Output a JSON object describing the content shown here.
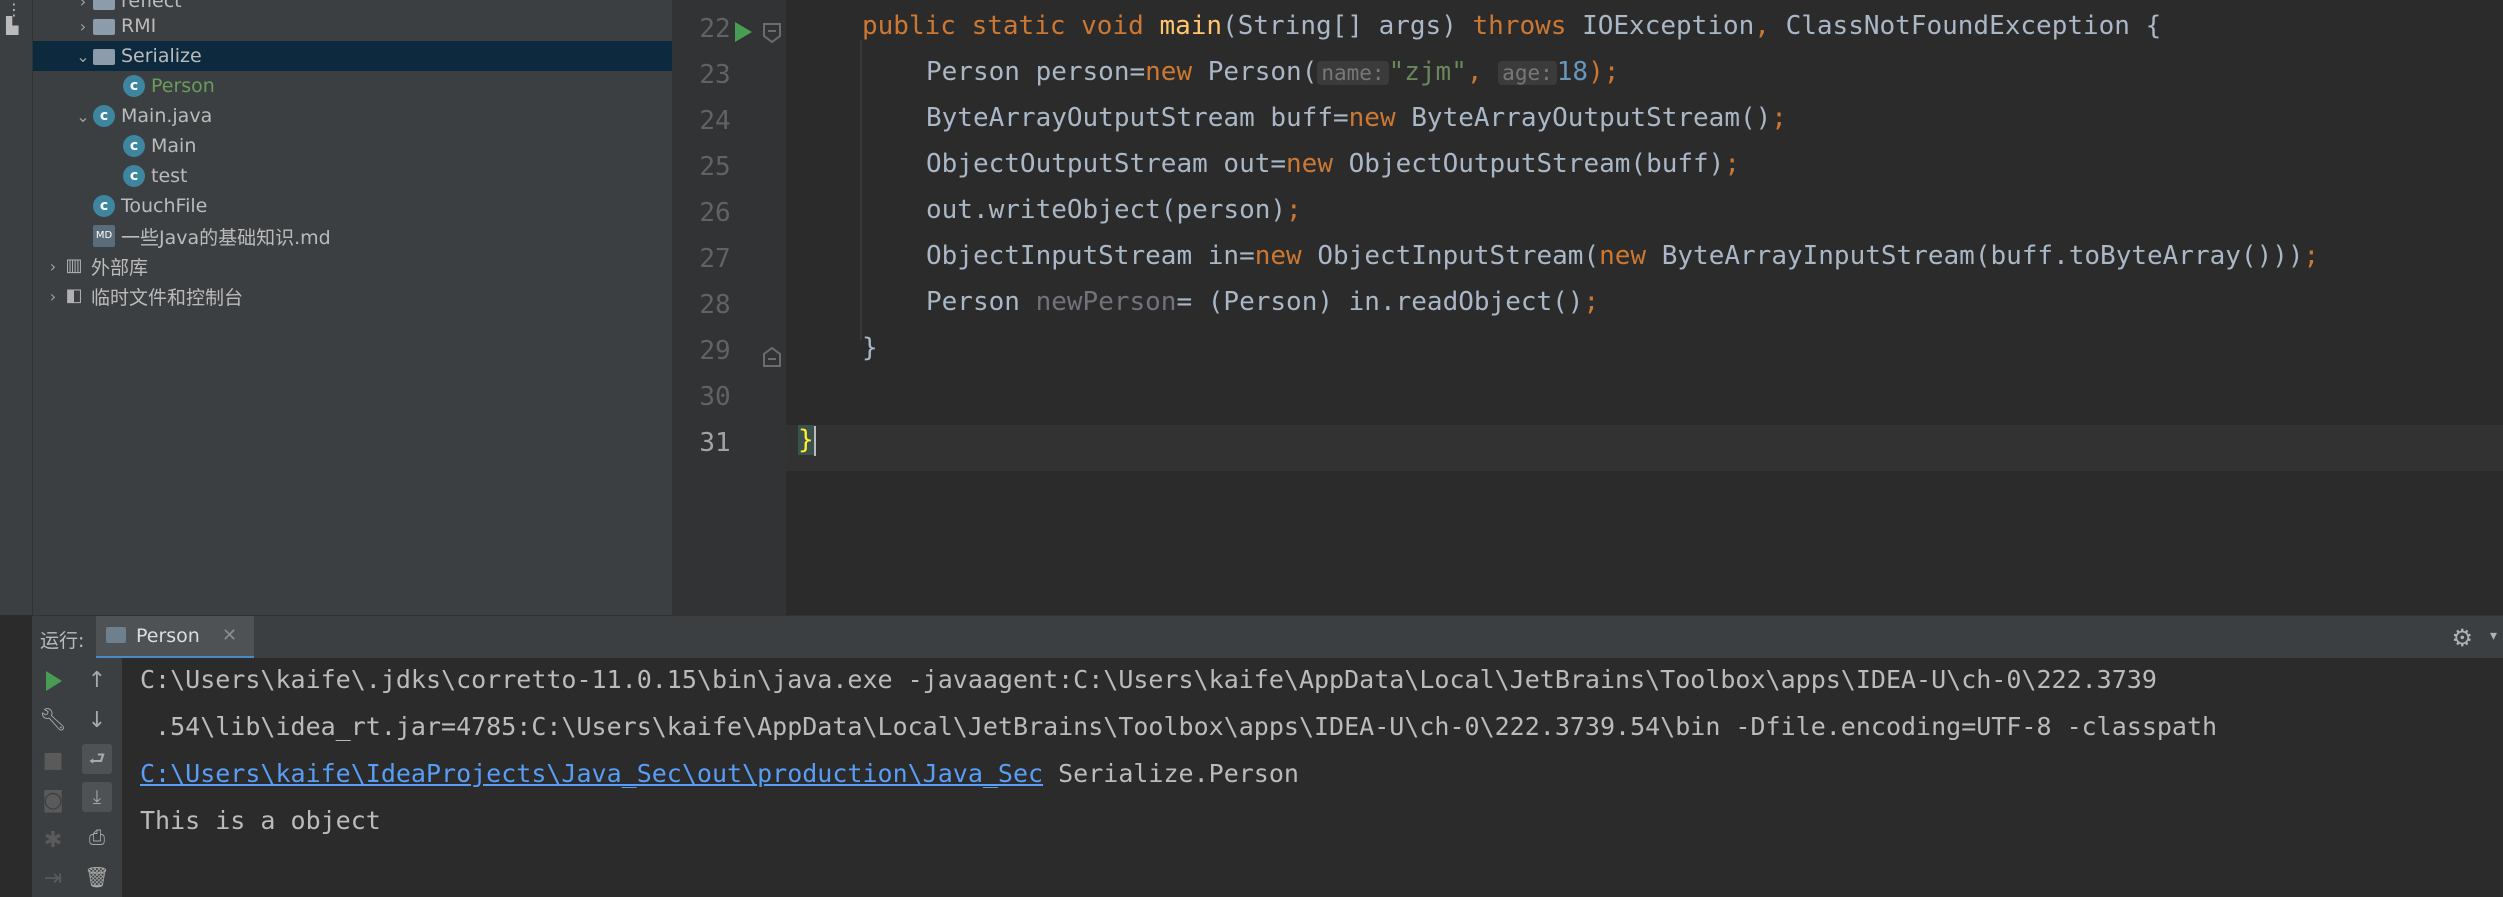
{
  "project_tree": [
    {
      "label": "reflect",
      "icon": "folder-icon",
      "expanded": false,
      "depth": 1
    },
    {
      "label": "RMI",
      "icon": "folder-icon",
      "expanded": false,
      "depth": 1
    },
    {
      "label": "Serialize",
      "icon": "folder-icon",
      "expanded": true,
      "depth": 1,
      "selected": true
    },
    {
      "label": "Person",
      "icon": "class-icon",
      "depth": 2
    },
    {
      "label": "Main.java",
      "icon": "java-file-icon",
      "expanded": true,
      "depth": 1
    },
    {
      "label": "Main",
      "icon": "class-icon",
      "depth": 2
    },
    {
      "label": "test",
      "icon": "class-icon",
      "depth": 2
    },
    {
      "label": "TouchFile",
      "icon": "class-icon",
      "depth": 1
    },
    {
      "label": "一些Java的基础知识.md",
      "icon": "markdown-file-icon",
      "depth": 1
    },
    {
      "label": "外部库",
      "icon": "library-icon",
      "expanded": false,
      "depth": 0
    },
    {
      "label": "临时文件和控制台",
      "icon": "scratch-icon",
      "expanded": false,
      "depth": 0
    }
  ],
  "editor": {
    "line_numbers": [
      "22",
      "23",
      "24",
      "25",
      "26",
      "27",
      "28",
      "29",
      "30",
      "31"
    ],
    "current_line": "31",
    "code": {
      "l22": {
        "public": "public",
        "static": "static",
        "void": "void",
        "main": "main",
        "params": "(String[] args) ",
        "throws": "throws",
        "exc1": " IOException",
        "comma": ",",
        "exc2": " ClassNotFoundException {"
      },
      "l23": {
        "a": "Person person=",
        "new": "new",
        "b": " Person(",
        "hint_name": "name:",
        "str": "\"zjm\"",
        "c": ",",
        "hint_age": "age:",
        "num": "18",
        "d": ");"
      },
      "l24": {
        "a": "ByteArrayOutputStream buff=",
        "new": "new",
        "b": " ByteArrayOutputStream()",
        "semi": ";"
      },
      "l25": {
        "a": "ObjectOutputStream out=",
        "new": "new",
        "b": " ObjectOutputStream(buff)",
        "semi": ";"
      },
      "l26": {
        "a": "out.writeObject(person)",
        "semi": ";"
      },
      "l27": {
        "a": "ObjectInputStream in=",
        "new": "new",
        "b": " ObjectInputStream(",
        "new2": "new",
        "c": " ByteArrayInputStream(buff.toByteArray()))",
        "semi": ";"
      },
      "l28": {
        "a": "Person ",
        "var": "newPerson",
        "b": "= (Person) in.readObject()",
        "semi": ";"
      },
      "l29": {
        "a": "}"
      },
      "l31": {
        "a": "}"
      }
    }
  },
  "run_panel": {
    "label": "运行:",
    "tab_label": "Person",
    "output": {
      "line1": "C:\\Users\\kaife\\.jdks\\corretto-11.0.15\\bin\\java.exe -javaagent:C:\\Users\\kaife\\AppData\\Local\\JetBrains\\Toolbox\\apps\\IDEA-U\\ch-0\\222.3739",
      "line2": " .54\\lib\\idea_rt.jar=4785:C:\\Users\\kaife\\AppData\\Local\\JetBrains\\Toolbox\\apps\\IDEA-U\\ch-0\\222.3739.54\\bin -Dfile.encoding=UTF-8 -classpath",
      "line3_link": "C:\\Users\\kaife\\IdeaProjects\\Java_Sec\\out\\production\\Java_Sec",
      "line3_rest": " Serialize.Person",
      "line4": "This is a object"
    }
  },
  "colors": {
    "keyword": "#cc7832",
    "function": "#ffc66d",
    "string": "#6a8759",
    "number": "#6897bb",
    "link": "#589df6",
    "selection": "#0d293e"
  }
}
